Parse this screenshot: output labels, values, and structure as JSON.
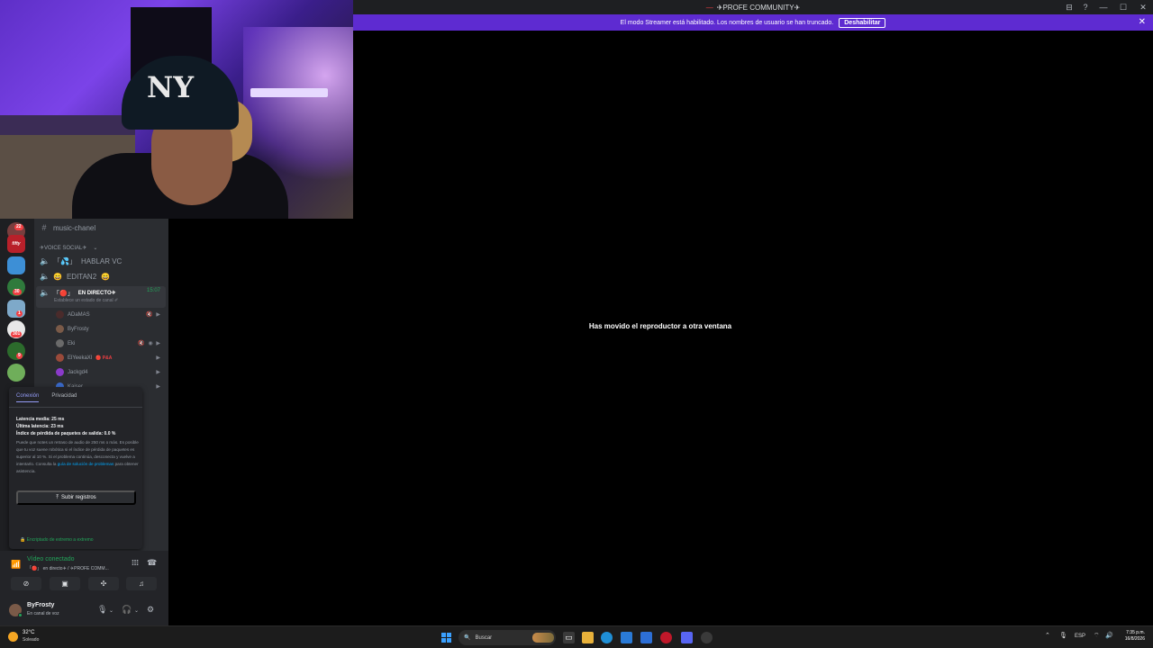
{
  "window": {
    "title": "✈PROFE COMMUNITY✈",
    "controls": [
      "⊟",
      "?",
      "—",
      "☐",
      "✕"
    ]
  },
  "banner": {
    "text": "El modo Streamer está habilitado. Los nombres de usuario se han truncado.",
    "button": "Deshabilitar"
  },
  "main": {
    "moved_message": "Has movido el reproductor a otra ventana"
  },
  "webcam": {
    "cap_logo": "NY"
  },
  "servers": [
    {
      "badge": "22",
      "color": "#7a3e3e"
    },
    {
      "badge": "",
      "label": "fifty",
      "color": "#b8202a"
    },
    {
      "badge": "",
      "color": "#3d8fd6"
    },
    {
      "badge": "30",
      "color": "#2f7a3c"
    },
    {
      "badge": "1",
      "color": "#7ea9c9"
    },
    {
      "badge": "301",
      "color": "#e8e8e8"
    },
    {
      "badge": "9",
      "color": "#2c6b2c"
    },
    {
      "badge": "",
      "color": "#6fae5a"
    }
  ],
  "channels": {
    "text_channel": "music-chanel",
    "category": "✈VOICE SOCIAL✈",
    "voice": [
      {
        "name": "HABLAR VC",
        "prefix": "「💦」"
      },
      {
        "name": "EDITAN2",
        "prefix": "😄",
        "suffix": "😄"
      }
    ],
    "active_voice": {
      "prefix": "「🔴」",
      "name": "EN DIRECTO✈",
      "timer": "15:07",
      "status_hint": "Establece un estado de canal ✐"
    },
    "members": [
      {
        "name": "ADaMAS",
        "icons": "🔇 ▶",
        "color": "#4a2b2b"
      },
      {
        "name": "ByFrosty",
        "icons": "",
        "color": "#7a5a48"
      },
      {
        "name": "Eki",
        "icons": "🔇 ◉ ▶",
        "color": "#6a6a6a"
      },
      {
        "name": "ElYeekaXl",
        "tag": "🔴 P&A",
        "icons": "▶",
        "color": "#9a4a3a"
      },
      {
        "name": "Jackgd4",
        "icons": "▶",
        "color": "#8a3ac9"
      },
      {
        "name": "Kaiser",
        "icons": "▶",
        "color": "#3a6ac9"
      }
    ]
  },
  "connection_popup": {
    "tabs": [
      "Conexión",
      "Privacidad"
    ],
    "avg_latency": "Latencia media: 25 ms",
    "last_latency": "Última latencia: 23 ms",
    "packet_loss": "Índice de pérdida de paquetes de salida: 0.0 %",
    "note": "Puede que notes un retraso de audio de 250 ms o más. Es posible que tu voz suene robótica si el índice de pérdida de paquetes es superior al 10 %. Si el problema continúa, desconecta y vuelve a intentarlo. Consulta la",
    "note_link": "guía de solución de problemas",
    "note_end": "para obtener asistencia.",
    "upload": "Subir registros",
    "encryption": "🔒 Encriptado de extremo a extremo"
  },
  "voice_panel": {
    "title": "Vídeo conectado",
    "subtitle": "「🔴」 en directo✈ / ✈PROFE COMM..."
  },
  "user": {
    "name": "ByFrosty",
    "status": "En canal de voz"
  },
  "taskbar": {
    "temp": "32°C",
    "weather": "Soleado",
    "search": "Buscar",
    "lang": "ESP",
    "time": "7:35 p.m.",
    "date": "16/8/2026"
  }
}
